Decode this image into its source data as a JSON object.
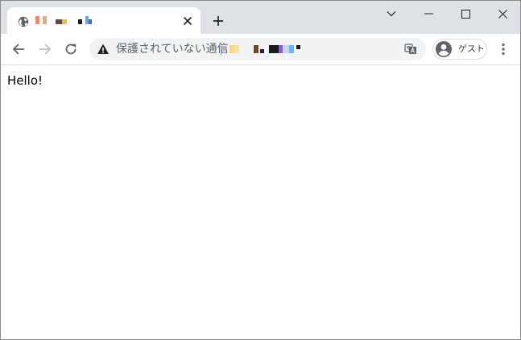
{
  "tab": {
    "title_pixels": [
      "#e08f6a",
      "#d8b27d",
      "#5a4b44",
      "#e7b96a",
      "#1c1c1c",
      "#6fa2e0",
      "#3b6fcf"
    ]
  },
  "omnibox": {
    "security_label": "保護されていない通信",
    "url_pixels": [
      "#f7d88a",
      "#f3e2a8",
      "#6b4a2a",
      "#3b1450",
      "#1a1a1a",
      "#8b5fc0",
      "#c5d8f0",
      "#6fb2ef",
      "#1a1a1a"
    ]
  },
  "profile": {
    "label": "ゲスト"
  },
  "page": {
    "text": "Hello!"
  },
  "colors": {
    "tabstrip": "#dee1e6",
    "omnibox_bg": "#f1f3f4",
    "icon": "#5f6368"
  },
  "icons": {
    "favicon": "globe-icon",
    "tab_close": "close-icon",
    "new_tab": "plus-icon",
    "tab_search": "chevron-down-icon",
    "minimize": "minimize-icon",
    "maximize": "maximize-icon",
    "close_window": "close-icon",
    "back": "arrow-left-icon",
    "forward": "arrow-right-icon",
    "reload": "reload-icon",
    "warning": "warning-icon",
    "translate": "translate-icon",
    "avatar": "account-icon",
    "menu": "kebab-menu-icon"
  }
}
